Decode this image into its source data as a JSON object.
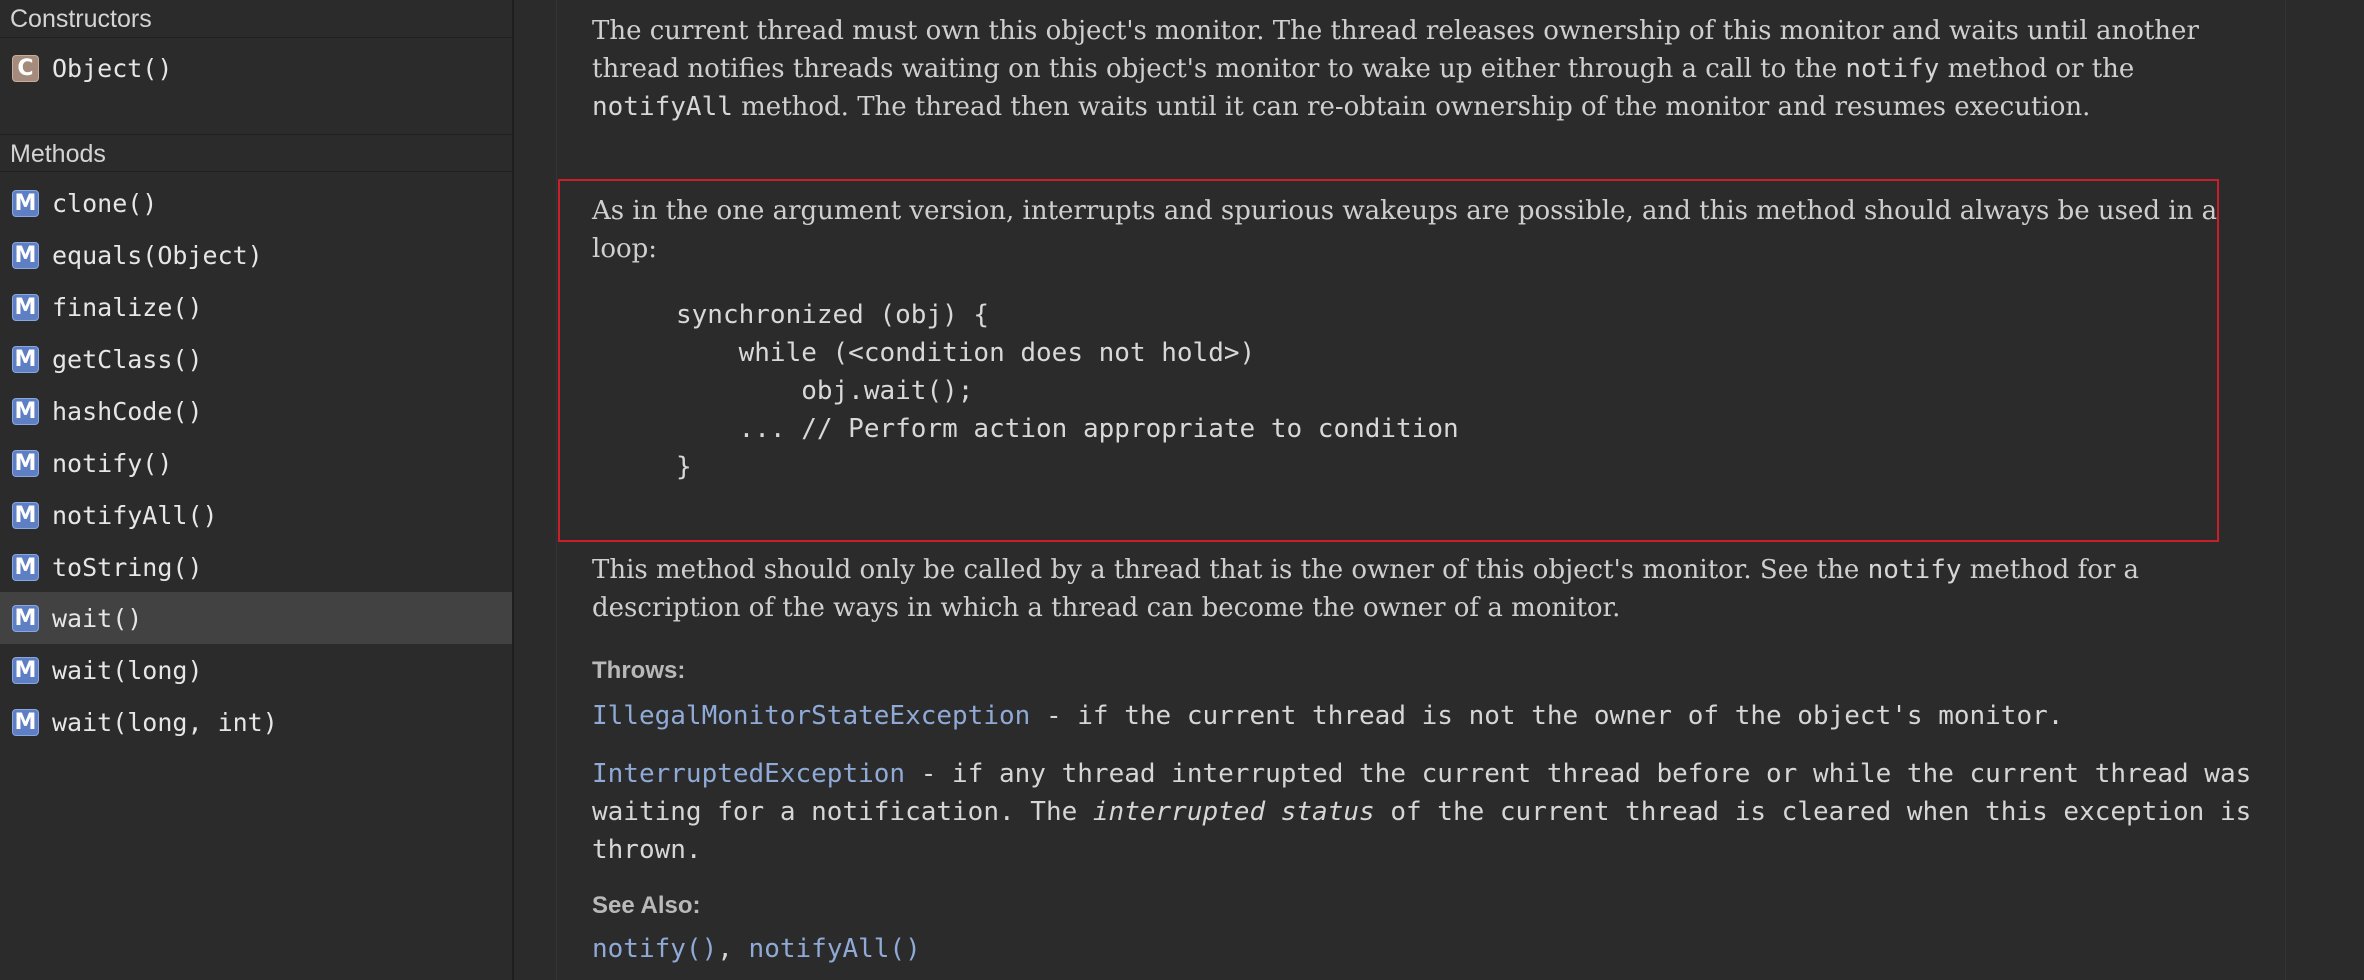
{
  "sidebar": {
    "constructors_header": "Constructors",
    "constructors": [
      {
        "badge": "C",
        "label": "Object()"
      }
    ],
    "methods_header": "Methods",
    "methods": [
      {
        "badge": "M",
        "label": "clone()"
      },
      {
        "badge": "M",
        "label": "equals(Object)"
      },
      {
        "badge": "M",
        "label": "finalize()"
      },
      {
        "badge": "M",
        "label": "getClass()"
      },
      {
        "badge": "M",
        "label": "hashCode()"
      },
      {
        "badge": "M",
        "label": "notify()"
      },
      {
        "badge": "M",
        "label": "notifyAll()"
      },
      {
        "badge": "M",
        "label": "toString()"
      },
      {
        "badge": "M",
        "label": "wait()",
        "selected": true
      },
      {
        "badge": "M",
        "label": "wait(long)"
      },
      {
        "badge": "M",
        "label": "wait(long, int)"
      }
    ]
  },
  "doc": {
    "para1": {
      "t1": "The current thread must own this object's monitor. The thread releases ownership of this monitor and waits until another thread notifies threads waiting on this object's monitor to wake up either through a call to the ",
      "c1": "notify",
      "t2": " method or the ",
      "c2": "notifyAll",
      "t3": " method. The thread then waits until it can re-obtain ownership of the monitor and resumes execution."
    },
    "para2": "As in the one argument version, interrupts and spurious wakeups are possible, and this method should always be used in a loop:",
    "code_lines": [
      "synchronized (obj) {",
      "    while (<condition does not hold>)",
      "        obj.wait();",
      "    ... // Perform action appropriate to condition",
      "}"
    ],
    "para3": {
      "t1": "This method should only be called by a thread that is the owner of this object's monitor. See the ",
      "c1": "notify",
      "t2": " method for a description of the ways in which a thread can become the owner of a monitor."
    },
    "throws_label": "Throws:",
    "throws": [
      {
        "exception": "IllegalMonitorStateException",
        "text": " - if the current thread is not the owner of the object's monitor."
      },
      {
        "exception": "InterruptedException",
        "text1": " - if any thread interrupted the current thread before or while the current thread was waiting for a notification. The ",
        "emph": "interrupted status",
        "text2": " of the current thread is cleared when this exception is thrown."
      }
    ],
    "see_also_label": "See Also:",
    "see_also": [
      "notify()",
      "notifyAll()"
    ],
    "see_also_sep": ", "
  },
  "colors": {
    "background": "#2b2b2b",
    "selection": "#424242",
    "link": "#8faad6",
    "highlight_border": "#c8202a",
    "method_badge": "#5f7fc4",
    "constructor_badge": "#a58b7b"
  }
}
